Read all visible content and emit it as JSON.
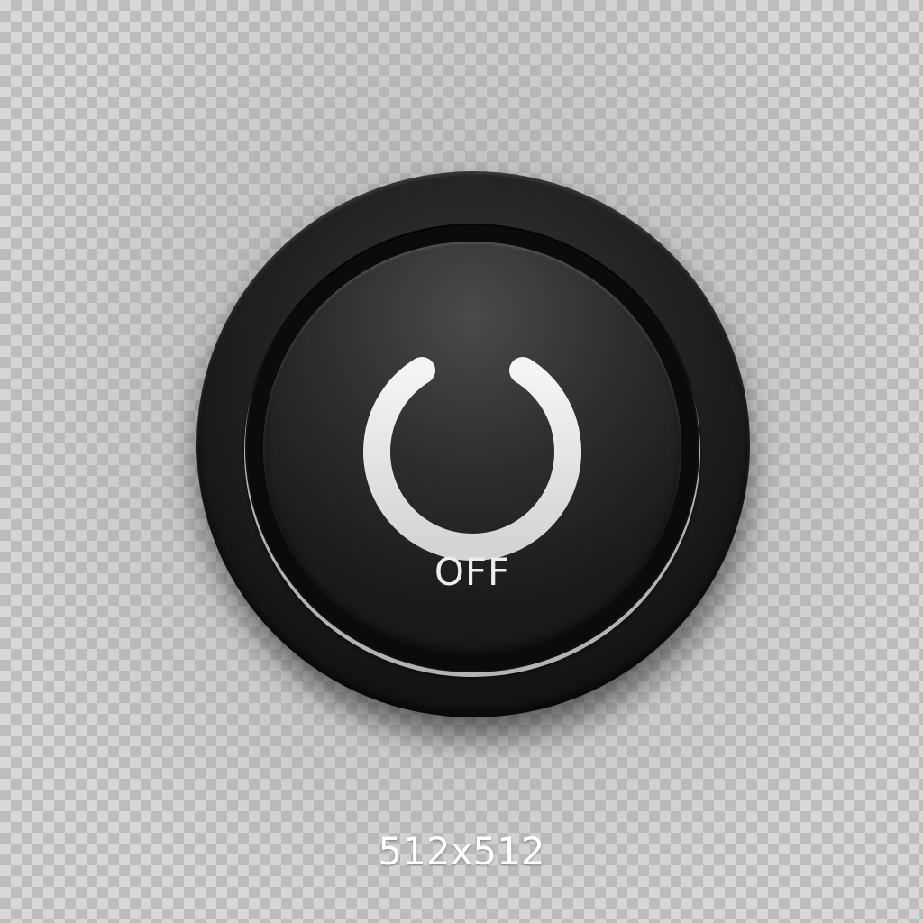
{
  "button": {
    "state_label": "OFF",
    "icon": "power-icon"
  },
  "caption": {
    "text": "512x512"
  },
  "colors": {
    "button_body": "#1c1c1c",
    "icon_and_text": "#ededed",
    "checker_light": "#d7d7d7",
    "checker_dark": "#bdbdbd"
  }
}
